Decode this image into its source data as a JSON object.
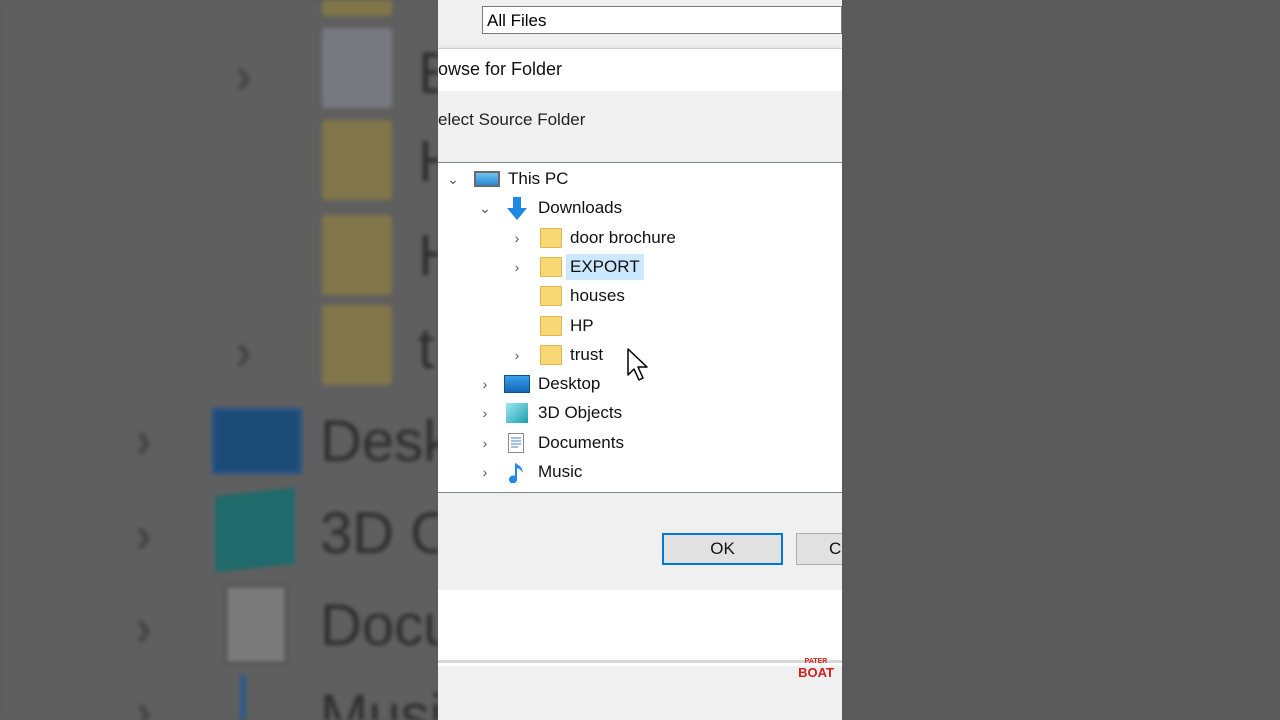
{
  "filter": {
    "value": "All Files"
  },
  "dialog": {
    "title": "owse for Folder",
    "prompt": "elect Source Folder",
    "ok_label": "OK",
    "cancel_label": "C"
  },
  "tree": {
    "this_pc": "This PC",
    "downloads": "Downloads",
    "folders": [
      "door brochure",
      "EXPORT",
      "houses",
      "HP",
      "trust"
    ],
    "desktop": "Desktop",
    "objects3d": "3D Objects",
    "documents": "Documents",
    "music": "Music"
  },
  "background_ghost_text": [
    "E",
    "H",
    "H",
    "t",
    "Desk",
    "3D O",
    "Docu",
    "Musi"
  ],
  "watermark": {
    "line1": "PATER",
    "line2": "BOAT"
  },
  "colors": {
    "selection": "#cce8ff",
    "ok_border": "#0078d7",
    "folder": "#f8d775"
  }
}
